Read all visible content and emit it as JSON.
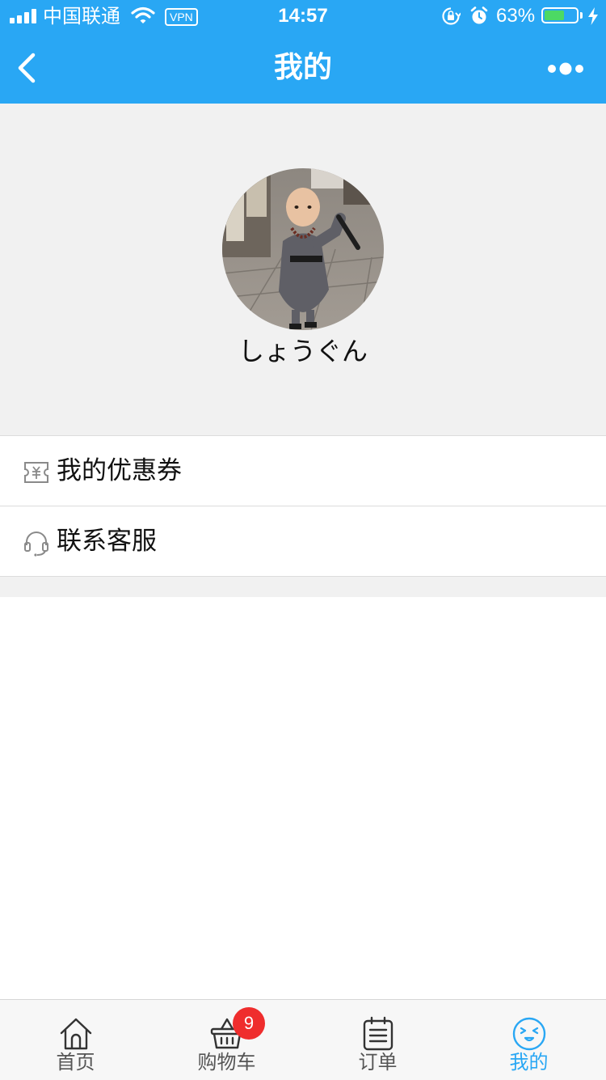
{
  "status_bar": {
    "carrier": "中国联通",
    "vpn": "VPN",
    "time": "14:57",
    "battery_percent": "63%",
    "battery_level": 0.63,
    "icons": [
      "signal-icon",
      "wifi-icon",
      "rotation-lock-icon",
      "alarm-icon",
      "battery-icon",
      "charging-icon"
    ]
  },
  "nav": {
    "title": "我的",
    "back_icon": "chevron-left-icon",
    "more_icon": "more-dots-icon"
  },
  "profile": {
    "username": "しょうぐん",
    "avatar": "avatar-photo"
  },
  "menu": {
    "items": [
      {
        "label": "我的优惠券",
        "icon": "coupon-icon"
      },
      {
        "label": "联系客服",
        "icon": "headset-icon"
      }
    ]
  },
  "tabbar": {
    "tabs": [
      {
        "label": "首页",
        "icon": "home-icon",
        "active": false
      },
      {
        "label": "购物车",
        "icon": "basket-icon",
        "active": false,
        "badge": "9"
      },
      {
        "label": "订单",
        "icon": "order-list-icon",
        "active": false
      },
      {
        "label": "我的",
        "icon": "smiley-face-icon",
        "active": true
      }
    ]
  },
  "colors": {
    "brand_blue": "#29a7f4",
    "page_background": "#f1f1f1",
    "badge_red": "#ef2d2d",
    "battery_green": "#4cd964"
  }
}
